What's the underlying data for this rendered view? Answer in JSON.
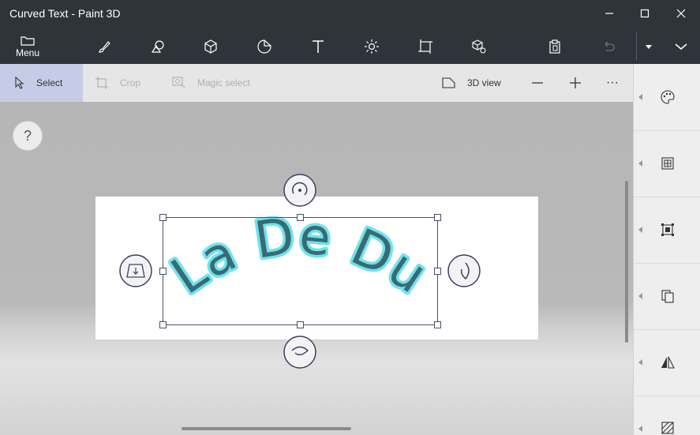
{
  "window": {
    "title": "Curved Text - Paint 3D"
  },
  "ribbon": {
    "menu_label": "Menu"
  },
  "toolbar": {
    "select_label": "Select",
    "crop_label": "Crop",
    "magic_select_label": "Magic select",
    "view3d_label": "3D view",
    "more_label": "···"
  },
  "canvas": {
    "help_label": "?",
    "curved_text": "La De Du",
    "text_colors": {
      "fill": "#3a6b73",
      "outline": "#6fe3ee"
    }
  },
  "colors": {
    "accent_selected": "#c7cce6",
    "titlebar": "#2f343b"
  }
}
